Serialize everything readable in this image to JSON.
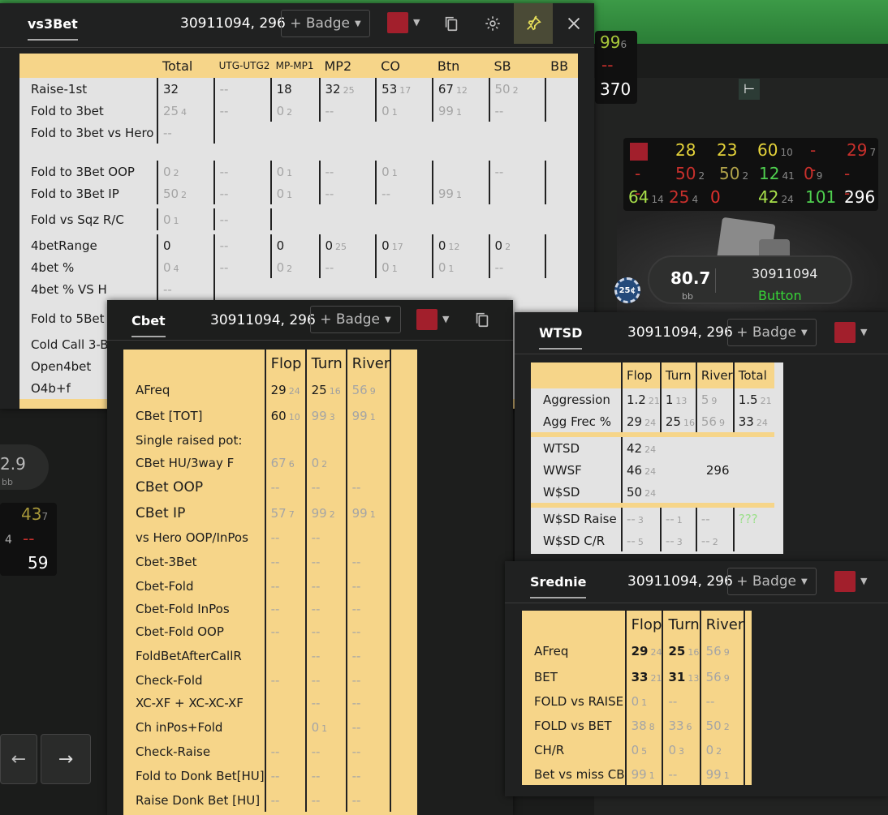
{
  "background": {
    "hud_left": {
      "val1": "2.9",
      "unit1": "bb",
      "v43": "43",
      "v43_sub": "7",
      "v4": "4",
      "dash": "--",
      "v59": "59"
    },
    "hud_top": {
      "v99": "99",
      "v99_sub": "6",
      "dash": "--",
      "v370": "370"
    },
    "hud_right": {
      "row1": [
        {
          "v": "28",
          "c": "#e5d33a"
        },
        {
          "v": "23",
          "c": "#e5d33a"
        },
        {
          "v": "60",
          "s": "10",
          "c": "#e5d33a"
        },
        {
          "v": "--",
          "c": "#c9302c"
        },
        {
          "v": "29",
          "s": "7",
          "c": "#c9302c"
        }
      ],
      "row2": [
        {
          "v": "--",
          "c": "#c9302c"
        },
        {
          "v": "50",
          "s": "2",
          "c": "#c9302c"
        },
        {
          "v": "50",
          "s": "2",
          "c": "#b0a24a"
        },
        {
          "v": "12",
          "s": "41",
          "c": "#4fd04f"
        },
        {
          "v": "0",
          "s": "9",
          "c": "#c9302c"
        },
        {
          "v": "--",
          "c": "#c9302c"
        }
      ],
      "row3": [
        {
          "v": "64",
          "s": "14",
          "c": "#a8e04a"
        },
        {
          "v": "25",
          "s": "4",
          "c": "#c9302c"
        },
        {
          "v": "0",
          "c": "#e0302c"
        },
        {
          "v": "42",
          "s": "24",
          "c": "#a8e04a"
        },
        {
          "v": "101",
          "c": "#4fd04f"
        },
        {
          "v": "296",
          "c": "#ffffff"
        }
      ]
    },
    "player": {
      "stack": "80.7",
      "unit": "bb",
      "name": "30911094",
      "position": "Button",
      "chip": "25¢"
    },
    "nav": {
      "prev": "←",
      "next": "→"
    }
  },
  "vs3bet": {
    "tab": "vs3Bet",
    "hero": "30911094, 296",
    "badge": "+ Badge",
    "columns": [
      "Total",
      "UTG-UTG2",
      "MP-MP1",
      "MP2",
      "CO",
      "Btn",
      "SB",
      "BB"
    ],
    "rows": [
      {
        "label": "Raise-1st",
        "cells": [
          [
            "32",
            ""
          ],
          [
            "--",
            ""
          ],
          [
            "18",
            ""
          ],
          [
            "32",
            "25"
          ],
          [
            "53",
            "17"
          ],
          [
            "67",
            "12"
          ],
          [
            "50",
            "2"
          ],
          [
            "",
            ""
          ]
        ]
      },
      {
        "label": "Fold to 3bet",
        "cells": [
          [
            "25",
            "4"
          ],
          [
            "--",
            ""
          ],
          [
            "0",
            "2"
          ],
          [
            "--",
            ""
          ],
          [
            "0",
            "1"
          ],
          [
            "99",
            "1"
          ],
          [
            "--",
            ""
          ],
          [
            "",
            ""
          ]
        ]
      },
      {
        "label": "Fold to 3bet vs Hero",
        "cells": [
          [
            "--",
            ""
          ]
        ]
      },
      {
        "label": "Fold to 3Bet OOP",
        "cells": [
          [
            "0",
            "2"
          ],
          [
            "--",
            ""
          ],
          [
            "0",
            "1"
          ],
          [
            "--",
            ""
          ],
          [
            "0",
            "1"
          ],
          [
            "",
            ""
          ],
          [
            "--",
            ""
          ],
          [
            "",
            ""
          ]
        ]
      },
      {
        "label": "Fold to 3Bet IP",
        "cells": [
          [
            "50",
            "2"
          ],
          [
            "--",
            ""
          ],
          [
            "0",
            "1"
          ],
          [
            "--",
            ""
          ],
          [
            "--",
            ""
          ],
          [
            "99",
            "1"
          ],
          [
            "",
            ""
          ],
          [
            "",
            ""
          ]
        ]
      },
      {
        "label": "Fold vs Sqz R/C",
        "cells": [
          [
            "0",
            "1"
          ],
          [
            "--",
            ""
          ]
        ]
      },
      {
        "label": "4betRange",
        "cells": [
          [
            "0",
            ""
          ],
          [
            "--",
            ""
          ],
          [
            "0",
            ""
          ],
          [
            "0",
            "25"
          ],
          [
            "0",
            "17"
          ],
          [
            "0",
            "12"
          ],
          [
            "0",
            "2"
          ],
          [
            "",
            ""
          ]
        ]
      },
      {
        "label": "4bet %",
        "cells": [
          [
            "0",
            "4"
          ],
          [
            "--",
            ""
          ],
          [
            "0",
            "2"
          ],
          [
            "--",
            ""
          ],
          [
            "0",
            "1"
          ],
          [
            "0",
            "1"
          ],
          [
            "--",
            ""
          ],
          [
            "",
            ""
          ]
        ]
      },
      {
        "label": "4bet % VS H",
        "cells": [
          [
            "--",
            ""
          ]
        ]
      },
      {
        "label": "Fold to 5Bet",
        "cells": []
      },
      {
        "label": "Cold Call 3-B",
        "cells": []
      },
      {
        "label": "Open4bet",
        "cells": []
      },
      {
        "label": "O4b+f",
        "cells": []
      }
    ]
  },
  "cbet": {
    "tab": "Cbet",
    "hero": "30911094, 296",
    "badge": "+ Badge",
    "columns": [
      "Flop",
      "Turn",
      "River"
    ],
    "rows": [
      {
        "label": "AFreq",
        "cells": [
          [
            "29",
            "24",
            0
          ],
          [
            "25",
            "16",
            0
          ],
          [
            "56",
            "9",
            1
          ]
        ]
      },
      {
        "label": "CBet [TOT]",
        "cells": [
          [
            "60",
            "10",
            0
          ],
          [
            "99",
            "3",
            1
          ],
          [
            "99",
            "1",
            1
          ]
        ]
      },
      {
        "label": "Single raised pot:",
        "cells": []
      },
      {
        "label": "CBet HU/3way F",
        "cells": [
          [
            "67",
            "6",
            1
          ],
          [
            "0",
            "2",
            1
          ],
          [
            "",
            ""
          ]
        ]
      },
      {
        "label": "CBet OOP",
        "big": true,
        "cells": [
          [
            "--",
            "",
            1
          ],
          [
            "--",
            "",
            1
          ],
          [
            "--",
            "",
            1
          ]
        ]
      },
      {
        "label": "CBet IP",
        "big": true,
        "cells": [
          [
            "57",
            "7",
            1
          ],
          [
            "99",
            "2",
            1
          ],
          [
            "99",
            "1",
            1
          ]
        ]
      },
      {
        "label": "vs Hero OOP/InPos",
        "cells": [
          [
            "--",
            "",
            1
          ],
          [
            "--",
            "",
            1
          ],
          [
            "",
            ""
          ]
        ]
      },
      {
        "label": "Cbet-3Bet",
        "cells": [
          [
            "--",
            "",
            1
          ],
          [
            "--",
            "",
            1
          ],
          [
            "--",
            "",
            1
          ]
        ]
      },
      {
        "label": "Cbet-Fold",
        "cells": [
          [
            "--",
            "",
            1
          ],
          [
            "--",
            "",
            1
          ],
          [
            "--",
            "",
            1
          ]
        ]
      },
      {
        "label": "Cbet-Fold InPos",
        "cells": [
          [
            "--",
            "",
            1
          ],
          [
            "--",
            "",
            1
          ],
          [
            "--",
            "",
            1
          ]
        ]
      },
      {
        "label": "Cbet-Fold OOP",
        "cells": [
          [
            "--",
            "",
            1
          ],
          [
            "--",
            "",
            1
          ],
          [
            "--",
            "",
            1
          ]
        ]
      },
      {
        "label": "FoldBetAfterCallR",
        "cells": [
          [
            "",
            ""
          ],
          [
            "--",
            "",
            1
          ],
          [
            "--",
            "",
            1
          ]
        ]
      },
      {
        "label": "Check-Fold",
        "cells": [
          [
            "--",
            "",
            1
          ],
          [
            "--",
            "",
            1
          ],
          [
            "--",
            "",
            1
          ]
        ]
      },
      {
        "label": "XC-XF + XC-XC-XF",
        "cells": [
          [
            "",
            ""
          ],
          [
            "--",
            "",
            1
          ],
          [
            "--",
            "",
            1
          ]
        ]
      },
      {
        "label": "Ch inPos+Fold",
        "cells": [
          [
            "",
            ""
          ],
          [
            "0",
            "1",
            1
          ],
          [
            "--",
            "",
            1
          ]
        ]
      },
      {
        "label": "Check-Raise",
        "cells": [
          [
            "--",
            "",
            1
          ],
          [
            "--",
            "",
            1
          ],
          [
            "--",
            "",
            1
          ]
        ]
      },
      {
        "label": "Fold to Donk Bet[HU]",
        "cells": [
          [
            "--",
            "",
            1
          ],
          [
            "--",
            "",
            1
          ],
          [
            "--",
            "",
            1
          ]
        ]
      },
      {
        "label": "Raise Donk Bet [HU]",
        "cells": [
          [
            "--",
            "",
            1
          ],
          [
            "--",
            "",
            1
          ],
          [
            "--",
            "",
            1
          ]
        ]
      }
    ]
  },
  "wtsd": {
    "tab": "WTSD",
    "hero": "30911094, 296",
    "badge": "+ Badge",
    "columns": [
      "Flop",
      "Turn",
      "River",
      "Total"
    ],
    "rows": [
      {
        "label": "Aggression",
        "cells": [
          [
            "1.2",
            "21",
            0
          ],
          [
            "1",
            "13",
            0
          ],
          [
            "5",
            "9",
            1
          ],
          [
            "1.5",
            "21",
            0
          ]
        ]
      },
      {
        "label": "Agg Frec %",
        "cells": [
          [
            "29",
            "24",
            0
          ],
          [
            "25",
            "16",
            0
          ],
          [
            "56",
            "9",
            1
          ],
          [
            "33",
            "24",
            0
          ]
        ]
      },
      {
        "label": "WTSD",
        "cells": [
          [
            "42",
            "24",
            0
          ]
        ]
      },
      {
        "label": "WWSF",
        "cells": [
          [
            "46",
            "24",
            0
          ]
        ],
        "extra": "296"
      },
      {
        "label": "W$SD",
        "cells": [
          [
            "50",
            "24",
            0
          ]
        ]
      },
      {
        "label": "W$SD Raise",
        "cells": [
          [
            "--",
            "3",
            1
          ],
          [
            "--",
            "1",
            1
          ],
          [
            "--",
            "",
            1
          ],
          [
            "???",
            "",
            2
          ]
        ]
      },
      {
        "label": "W$SD C/R",
        "cells": [
          [
            "--",
            "5",
            1
          ],
          [
            "--",
            "3",
            1
          ],
          [
            "--",
            "2",
            1
          ],
          [
            "",
            "",
            0
          ]
        ]
      }
    ]
  },
  "srednie": {
    "tab": "Srednie",
    "hero": "30911094, 296",
    "badge": "+ Badge",
    "columns": [
      "Flop",
      "Turn",
      "River"
    ],
    "rows": [
      {
        "label": "AFreq",
        "cells": [
          [
            "29",
            "24",
            0
          ],
          [
            "25",
            "16",
            0
          ],
          [
            "56",
            "9",
            1
          ]
        ]
      },
      {
        "label": "BET",
        "cells": [
          [
            "33",
            "21",
            0
          ],
          [
            "31",
            "13",
            0
          ],
          [
            "56",
            "9",
            1
          ]
        ]
      },
      {
        "label": "FOLD vs RAISE",
        "cells": [
          [
            "0",
            "1",
            1
          ],
          [
            "--",
            "",
            1
          ],
          [
            "--",
            "",
            1
          ]
        ]
      },
      {
        "label": "FOLD vs BET",
        "cells": [
          [
            "38",
            "8",
            1
          ],
          [
            "33",
            "6",
            1
          ],
          [
            "50",
            "2",
            1
          ]
        ]
      },
      {
        "label": "CH/R",
        "cells": [
          [
            "0",
            "5",
            1
          ],
          [
            "0",
            "3",
            1
          ],
          [
            "0",
            "2",
            1
          ]
        ]
      },
      {
        "label": "Bet vs miss CB",
        "cells": [
          [
            "99",
            "1",
            1
          ],
          [
            "--",
            "",
            1
          ],
          [
            "99",
            "1",
            1
          ]
        ]
      }
    ]
  }
}
